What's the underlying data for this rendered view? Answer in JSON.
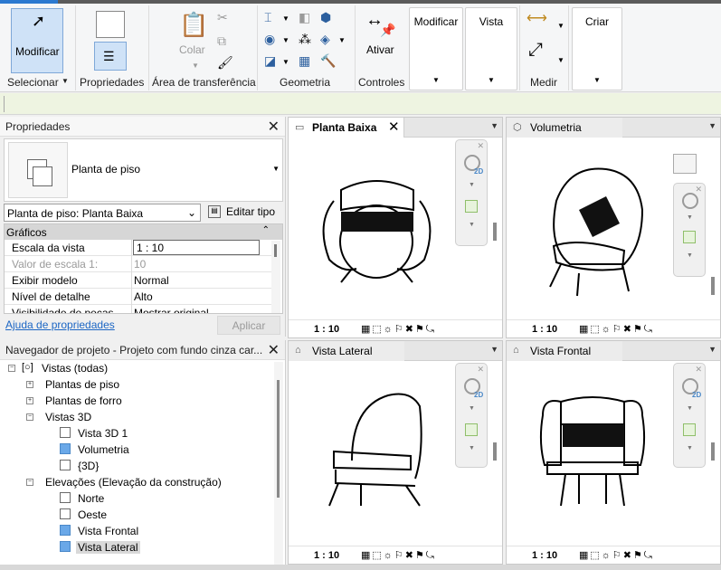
{
  "ribbon": {
    "modify_label": "Modificar",
    "select_label": "Selecionar",
    "properties_label": "Propriedades",
    "paste_label": "Colar",
    "clipboard_label": "Área de transferência",
    "geometry_label": "Geometria",
    "activate_label": "Ativar",
    "controls_label": "Controles",
    "modify_panel_label": "Modificar",
    "view_panel_label": "Vista",
    "measure_label": "Medir",
    "create_panel_label": "Criar"
  },
  "properties": {
    "title": "Propriedades",
    "type_name": "Planta de piso",
    "instance_selector": "Planta de piso: Planta Baixa",
    "edit_type_label": "Editar tipo",
    "section_title": "Gráficos",
    "rows": [
      {
        "key": "Escala da vista",
        "value": "1 : 10"
      },
      {
        "key": "Valor de escala    1:",
        "value": "10"
      },
      {
        "key": "Exibir modelo",
        "value": "Normal"
      },
      {
        "key": "Nível de detalhe",
        "value": "Alto"
      },
      {
        "key": "Visibilidade de peças",
        "value": "Mostrar original"
      }
    ],
    "help_link": "Ajuda de propriedades",
    "apply_label": "Aplicar"
  },
  "navigator": {
    "title": "Navegador de projeto - Projeto com fundo cinza car...",
    "items": [
      {
        "label": "Vistas (todas)"
      },
      {
        "label": "Plantas de piso"
      },
      {
        "label": "Plantas de forro"
      },
      {
        "label": "Vistas 3D"
      },
      {
        "label": "Vista 3D 1"
      },
      {
        "label": "Volumetria"
      },
      {
        "label": "{3D}"
      },
      {
        "label": "Elevações (Elevação da construção)"
      },
      {
        "label": "Norte"
      },
      {
        "label": "Oeste"
      },
      {
        "label": "Vista Frontal"
      },
      {
        "label": "Vista Lateral"
      }
    ]
  },
  "views": {
    "plan": {
      "title": "Planta Baixa",
      "scale": "1 : 10"
    },
    "volume": {
      "title": "Volumetria",
      "scale": "1 : 10"
    },
    "side": {
      "title": "Vista Lateral",
      "scale": "1 : 10"
    },
    "front": {
      "title": "Vista Frontal",
      "scale": "1 : 10"
    },
    "nav_2d": "2D"
  },
  "colors": {
    "accent": "#2b79d0",
    "selected": "#cfe2f7"
  }
}
